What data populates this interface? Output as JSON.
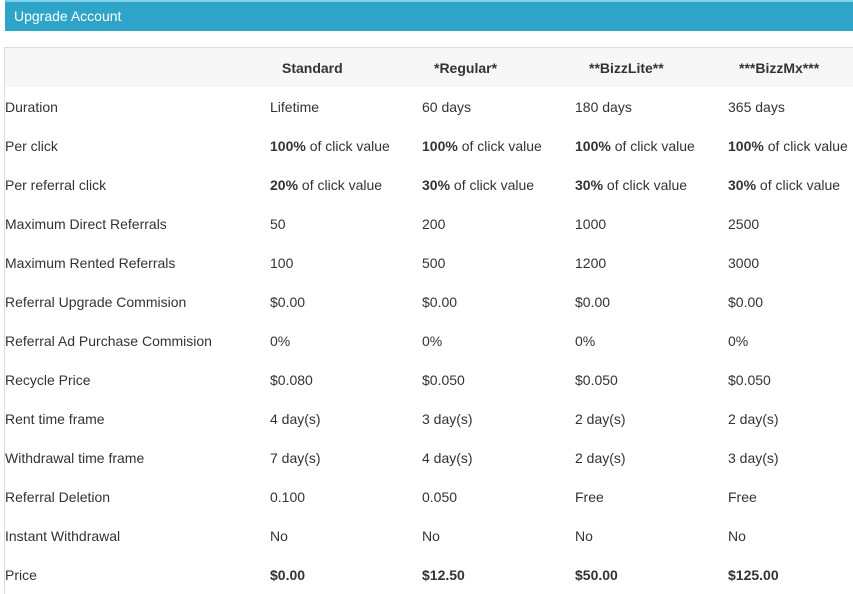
{
  "panel": {
    "title": "Upgrade Account"
  },
  "table": {
    "headers": [
      "",
      "Standard",
      "*Regular*",
      "**BizzLite**",
      "***BizzMx***"
    ],
    "rows": [
      {
        "label": "Duration",
        "cells": [
          {
            "strong": "",
            "text": "Lifetime"
          },
          {
            "strong": "",
            "text": "60 days"
          },
          {
            "strong": "",
            "text": "180 days"
          },
          {
            "strong": "",
            "text": "365 days"
          }
        ]
      },
      {
        "label": "Per click",
        "cells": [
          {
            "strong": "100%",
            "text": " of click value"
          },
          {
            "strong": "100%",
            "text": " of click value"
          },
          {
            "strong": "100%",
            "text": " of click value"
          },
          {
            "strong": "100%",
            "text": " of click value"
          }
        ]
      },
      {
        "label": "Per referral click",
        "cells": [
          {
            "strong": "20%",
            "text": " of click value"
          },
          {
            "strong": "30%",
            "text": " of click value"
          },
          {
            "strong": "30%",
            "text": " of click value"
          },
          {
            "strong": "30%",
            "text": " of click value"
          }
        ]
      },
      {
        "label": "Maximum Direct Referrals",
        "cells": [
          {
            "strong": "",
            "text": "50"
          },
          {
            "strong": "",
            "text": "200"
          },
          {
            "strong": "",
            "text": "1000"
          },
          {
            "strong": "",
            "text": "2500"
          }
        ]
      },
      {
        "label": "Maximum Rented Referrals",
        "cells": [
          {
            "strong": "",
            "text": "100"
          },
          {
            "strong": "",
            "text": "500"
          },
          {
            "strong": "",
            "text": "1200"
          },
          {
            "strong": "",
            "text": "3000"
          }
        ]
      },
      {
        "label": "Referral Upgrade Commision",
        "cells": [
          {
            "strong": "",
            "text": "$0.00"
          },
          {
            "strong": "",
            "text": "$0.00"
          },
          {
            "strong": "",
            "text": "$0.00"
          },
          {
            "strong": "",
            "text": "$0.00"
          }
        ]
      },
      {
        "label": "Referral Ad Purchase Commision",
        "cells": [
          {
            "strong": "",
            "text": "0%"
          },
          {
            "strong": "",
            "text": "0%"
          },
          {
            "strong": "",
            "text": "0%"
          },
          {
            "strong": "",
            "text": "0%"
          }
        ]
      },
      {
        "label": "Recycle Price",
        "cells": [
          {
            "strong": "",
            "text": "$0.080"
          },
          {
            "strong": "",
            "text": "$0.050"
          },
          {
            "strong": "",
            "text": "$0.050"
          },
          {
            "strong": "",
            "text": "$0.050"
          }
        ]
      },
      {
        "label": "Rent time frame",
        "cells": [
          {
            "strong": "",
            "text": "4 day(s)"
          },
          {
            "strong": "",
            "text": "3 day(s)"
          },
          {
            "strong": "",
            "text": "2 day(s)"
          },
          {
            "strong": "",
            "text": "2 day(s)"
          }
        ]
      },
      {
        "label": "Withdrawal time frame",
        "cells": [
          {
            "strong": "",
            "text": "7 day(s)"
          },
          {
            "strong": "",
            "text": "4 day(s)"
          },
          {
            "strong": "",
            "text": "2 day(s)"
          },
          {
            "strong": "",
            "text": "3 day(s)"
          }
        ]
      },
      {
        "label": "Referral Deletion",
        "cells": [
          {
            "strong": "",
            "text": "0.100"
          },
          {
            "strong": "",
            "text": "0.050"
          },
          {
            "strong": "",
            "text": "Free"
          },
          {
            "strong": "",
            "text": "Free"
          }
        ]
      },
      {
        "label": "Instant Withdrawal",
        "cells": [
          {
            "strong": "",
            "text": "No"
          },
          {
            "strong": "",
            "text": "No"
          },
          {
            "strong": "",
            "text": "No"
          },
          {
            "strong": "",
            "text": "No"
          }
        ]
      },
      {
        "label": "Price",
        "cells": [
          {
            "strong": "$0.00",
            "text": ""
          },
          {
            "strong": "$12.50",
            "text": ""
          },
          {
            "strong": "$50.00",
            "text": ""
          },
          {
            "strong": "$125.00",
            "text": ""
          }
        ]
      }
    ]
  }
}
